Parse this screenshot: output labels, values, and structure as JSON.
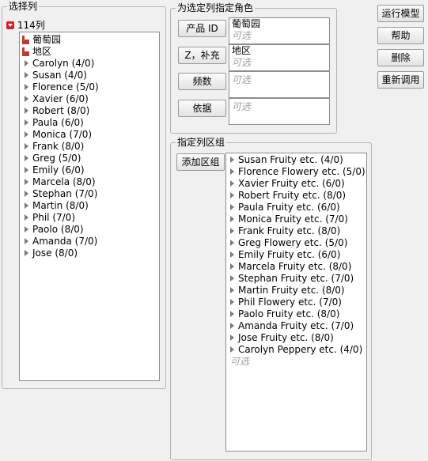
{
  "select_columns": {
    "title": "选择列",
    "count_label": "114列",
    "columns": [
      {
        "label": "葡萄园",
        "kind": "nominal"
      },
      {
        "label": "地区",
        "kind": "nominal"
      },
      {
        "label": "Carolyn (4/0)",
        "kind": "group"
      },
      {
        "label": "Susan (4/0)",
        "kind": "group"
      },
      {
        "label": "Florence (5/0)",
        "kind": "group"
      },
      {
        "label": "Xavier (6/0)",
        "kind": "group"
      },
      {
        "label": "Robert (8/0)",
        "kind": "group"
      },
      {
        "label": "Paula (6/0)",
        "kind": "group"
      },
      {
        "label": "Monica (7/0)",
        "kind": "group"
      },
      {
        "label": "Frank (8/0)",
        "kind": "group"
      },
      {
        "label": "Greg (5/0)",
        "kind": "group"
      },
      {
        "label": "Emily (6/0)",
        "kind": "group"
      },
      {
        "label": "Marcela (8/0)",
        "kind": "group"
      },
      {
        "label": "Stephan (7/0)",
        "kind": "group"
      },
      {
        "label": "Martin (8/0)",
        "kind": "group"
      },
      {
        "label": "Phil (7/0)",
        "kind": "group"
      },
      {
        "label": "Paolo (8/0)",
        "kind": "group"
      },
      {
        "label": "Amanda (7/0)",
        "kind": "group"
      },
      {
        "label": "Jose (8/0)",
        "kind": "group"
      }
    ]
  },
  "roles": {
    "title": "为选定列指定角色",
    "optional_text": "可选",
    "product_id": {
      "button": "产品 ID",
      "value": "葡萄园"
    },
    "z_supplement": {
      "button": "Z，补充",
      "value": "地区"
    },
    "freq": {
      "button": "频数"
    },
    "by": {
      "button": "依据"
    }
  },
  "block": {
    "title": "指定列区组",
    "add_button": "添加区组",
    "optional_text": "可选",
    "items": [
      "Susan Fruity etc. (4/0)",
      "Florence Flowery etc. (5/0)",
      "Xavier Fruity etc. (6/0)",
      "Robert Fruity etc. (8/0)",
      "Paula Fruity etc. (6/0)",
      "Monica Fruity etc. (7/0)",
      "Frank Fruity etc. (8/0)",
      "Greg Flowery etc. (5/0)",
      "Emily Fruity etc. (6/0)",
      "Marcela Fruity etc. (8/0)",
      "Stephan Fruity etc. (7/0)",
      "Martin Fruity etc. (8/0)",
      "Phil Flowery etc. (7/0)",
      "Paolo Fruity etc. (8/0)",
      "Amanda Fruity etc. (7/0)",
      "Jose Fruity etc. (8/0)",
      "Carolyn Peppery etc. (4/0)"
    ]
  },
  "actions": {
    "run": "运行模型",
    "help": "帮助",
    "remove": "删除",
    "recall": "重新调用"
  },
  "colors": {
    "nominal_icon": "#c0392b",
    "disclosure_red": "#d0202a"
  }
}
